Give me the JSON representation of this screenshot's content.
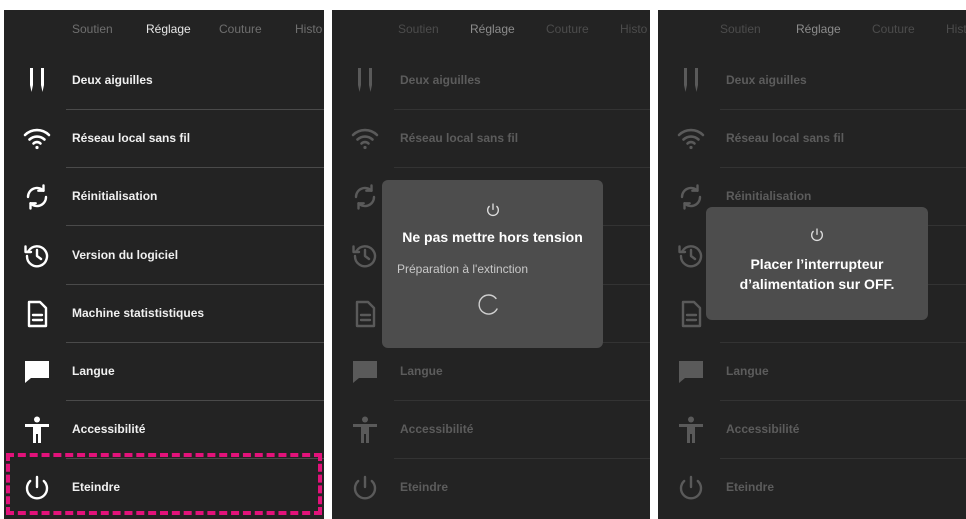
{
  "tabs": [
    "Soutien",
    "Réglage",
    "Couture",
    "Histo"
  ],
  "active_tab": "Réglage",
  "menu": [
    {
      "label": "Deux aiguilles",
      "icon": "twin-needle-icon"
    },
    {
      "label": "Réseau local sans fil",
      "icon": "wifi-icon"
    },
    {
      "label": "Réinitialisation",
      "icon": "reset-icon"
    },
    {
      "label": "Version du logiciel",
      "icon": "software-version-icon"
    },
    {
      "label": "Machine statististiques",
      "icon": "document-icon"
    },
    {
      "label": "Langue",
      "icon": "speech-bubble-icon"
    },
    {
      "label": "Accessibilité",
      "icon": "accessibility-icon"
    },
    {
      "label": "Eteindre",
      "icon": "power-icon"
    }
  ],
  "dialog_shutdown": {
    "title": "Ne pas mettre hors tension",
    "subtitle": "Préparation à l'extinction",
    "icon": "power-icon"
  },
  "dialog_switch_off": {
    "title_line1": "Placer l’interrupteur",
    "title_line2": "d’alimentation sur OFF.",
    "icon": "power-icon"
  },
  "colors": {
    "background": "#232323",
    "dialog": "#4d4d4d",
    "highlight": "#e2127a"
  }
}
